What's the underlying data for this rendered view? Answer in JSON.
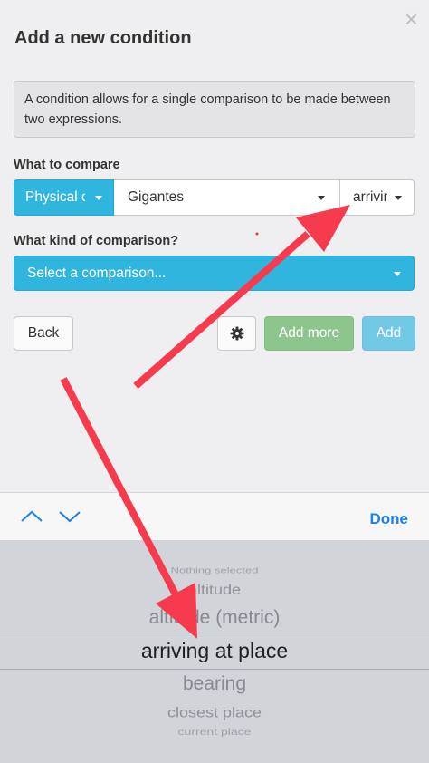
{
  "dialog": {
    "title": "Add a new condition",
    "close_glyph": "×",
    "info_text": "A condition allows for a single comparison to be made between two expressions.",
    "what_to_compare_label": "What to compare",
    "compare": {
      "physical": "Physical c",
      "gigantes": "Gigantes",
      "arriving": "arriving"
    },
    "kind_label": "What kind of comparison?",
    "comparison_placeholder": "Select a comparison...",
    "buttons": {
      "back": "Back",
      "settings_icon": "gear-icon",
      "add_more": "Add more",
      "add": "Add"
    }
  },
  "toolbar": {
    "prev_icon": "chevron-up-icon",
    "next_icon": "chevron-down-icon",
    "done_label": "Done"
  },
  "picker": {
    "options": [
      "Nothing selected",
      "altitude",
      "altitude (metric)",
      "arriving at place",
      "bearing",
      "closest place",
      "current place"
    ],
    "selected": "arriving at place"
  },
  "colors": {
    "primary_blue": "#2fb5de",
    "green": "#8cc68c",
    "light_blue": "#72c9e6",
    "done_blue": "#1a82e6",
    "annotation_red": "#f53b4d"
  }
}
